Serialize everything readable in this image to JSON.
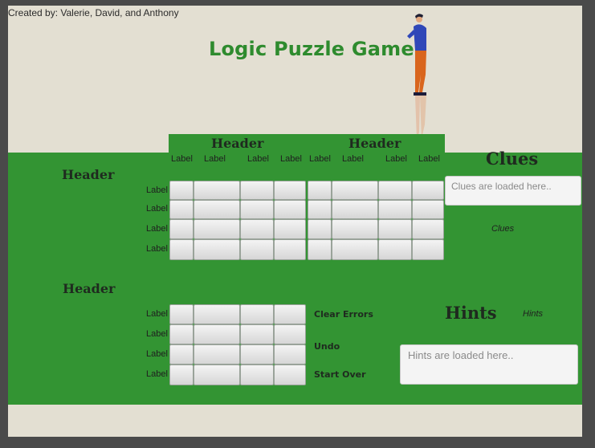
{
  "app": {
    "credit": "Created by: Valerie, David, and Anthony",
    "title": "Logic Puzzle Game"
  },
  "grid_top": {
    "header_left": "Header",
    "header_right": "Header",
    "col_labels": [
      "Label",
      "Label",
      "Label",
      "Label",
      "Label",
      "Label",
      "Label",
      "Label"
    ],
    "side_header": "Header",
    "row_labels": [
      "Label",
      "Label",
      "Label",
      "Label"
    ]
  },
  "grid_bottom": {
    "side_header": "Header",
    "row_labels": [
      "Label",
      "Label",
      "Label",
      "Label"
    ]
  },
  "clues": {
    "title": "Clues",
    "placeholder": "Clues are loaded here..",
    "label": "Clues"
  },
  "hints": {
    "title": "Hints",
    "label": "Hints",
    "placeholder": "Hints are loaded here.."
  },
  "actions": {
    "clear_errors": "Clear Errors",
    "undo": "Undo",
    "start_over": "Start Over"
  },
  "colors": {
    "green_panel": "#339433",
    "title_green": "#2e8b2e",
    "background": "#e3dfd2"
  }
}
